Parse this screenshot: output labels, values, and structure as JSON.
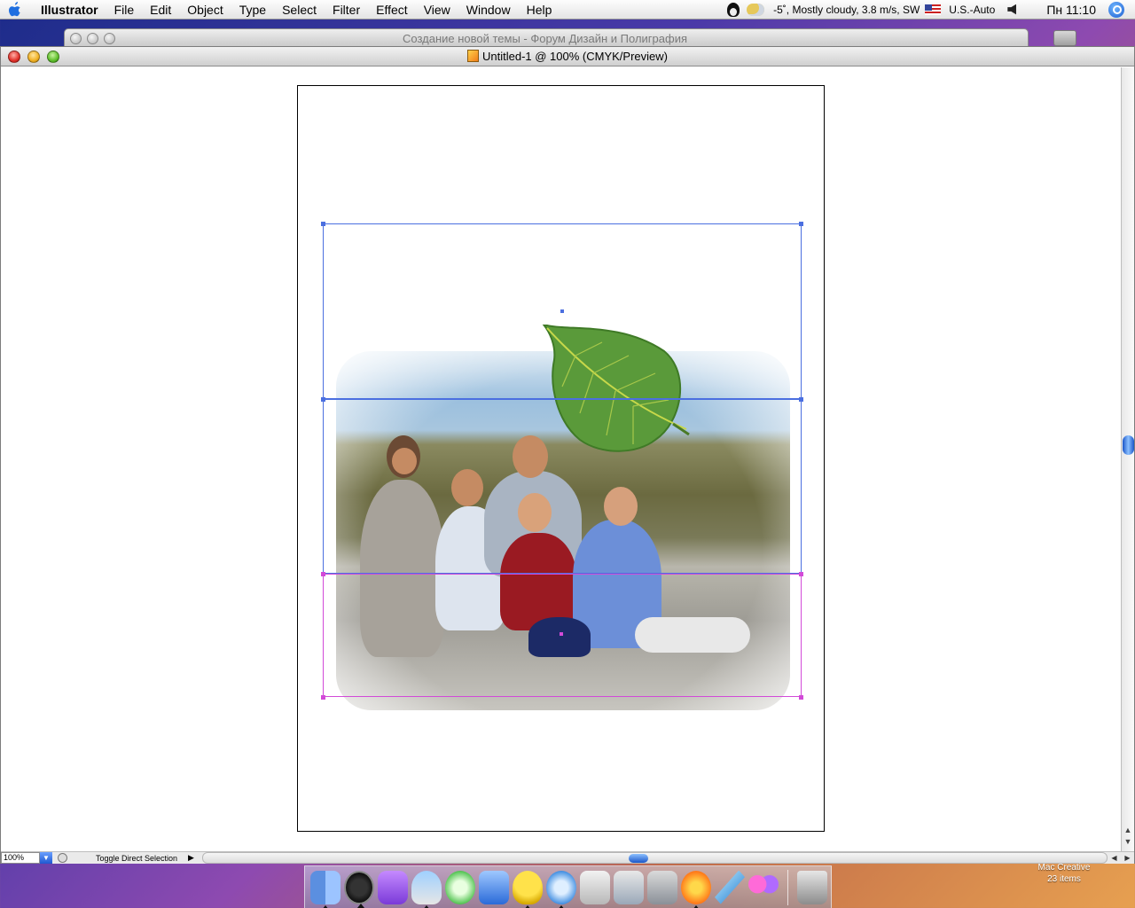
{
  "menubar": {
    "app_name": "Illustrator",
    "items": [
      "File",
      "Edit",
      "Object",
      "Type",
      "Select",
      "Filter",
      "Effect",
      "View",
      "Window",
      "Help"
    ],
    "weather": "-5˚, Mostly cloudy, 3.8 m/s, SW",
    "input_source": "U.S.-Auto",
    "clock": "Пн 11:10"
  },
  "background_window": {
    "title": "Создание новой темы - Форум Дизайн и Полиграфия"
  },
  "document": {
    "title": "Untitled-1 @ 100% (CMYK/Preview)"
  },
  "statusbar": {
    "zoom": "100%",
    "status_label": "Toggle Direct Selection"
  },
  "dock": {
    "items": [
      "Finder",
      "Dashboard",
      "iChat",
      "Weather",
      "iTunes",
      "Word",
      "Adium",
      "Safari",
      "System Info",
      "Mail",
      "Print Queue",
      "Flower",
      "Feather",
      "Butterfly",
      "Trash"
    ],
    "corner_label": "Mac Creative",
    "corner_count": "23 items"
  },
  "colors": {
    "selection_blue": "#4b6fe0",
    "selection_magenta": "#d24ad8"
  }
}
